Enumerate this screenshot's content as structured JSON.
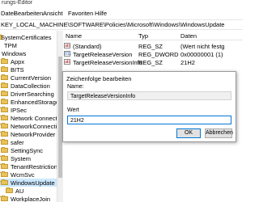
{
  "window": {
    "title": "rungs-Editor"
  },
  "menu": [
    "Datei",
    "Bearbeiten",
    "Ansicht",
    "Favoriten",
    "Hilfe"
  ],
  "address": "KEY_LOCAL_MACHINE\\SOFTWARE\\Policies\\Microsoft\\Windows\\WindowsUpdate",
  "tree": {
    "items": [
      {
        "label": "SystemCertificates"
      },
      {
        "label": "TPM"
      },
      {
        "label": "Windows"
      },
      {
        "label": "Appx"
      },
      {
        "label": "BITS"
      },
      {
        "label": "CurrentVersion"
      },
      {
        "label": "DataCollection"
      },
      {
        "label": "DriverSearching"
      },
      {
        "label": "EnhancedStorageDe"
      },
      {
        "label": "IPSec"
      },
      {
        "label": "Network Connection"
      },
      {
        "label": "NetworkConnectivity"
      },
      {
        "label": "NetworkProvider"
      },
      {
        "label": "safer"
      },
      {
        "label": "SettingSync"
      },
      {
        "label": "System"
      },
      {
        "label": "TenantRestrictions"
      },
      {
        "label": "WcmSvc"
      },
      {
        "label": "WindowsUpdate"
      },
      {
        "label": "AU"
      },
      {
        "label": "WorkplaceJoin"
      }
    ]
  },
  "list": {
    "headers": [
      "Name",
      "Typ",
      "Daten"
    ],
    "rows": [
      {
        "icon": "ab",
        "name": "(Standard)",
        "type": "REG_SZ",
        "data": "(Wert nicht festg"
      },
      {
        "icon": "011",
        "name": "TargetReleaseVersion",
        "type": "REG_DWORD",
        "data": "0x00000001 (1)"
      },
      {
        "icon": "ab",
        "name": "TargetReleaseVersionInfo",
        "type": "REG_SZ",
        "data": "21H2"
      }
    ]
  },
  "dialog": {
    "title": "Zeichenfolge bearbeiten",
    "name_label": "Name:",
    "name_value": "TargetReleaseVersionInfo",
    "value_label": "Wert",
    "value": "21H2",
    "ok": "OK",
    "cancel": "Abbrechen"
  }
}
